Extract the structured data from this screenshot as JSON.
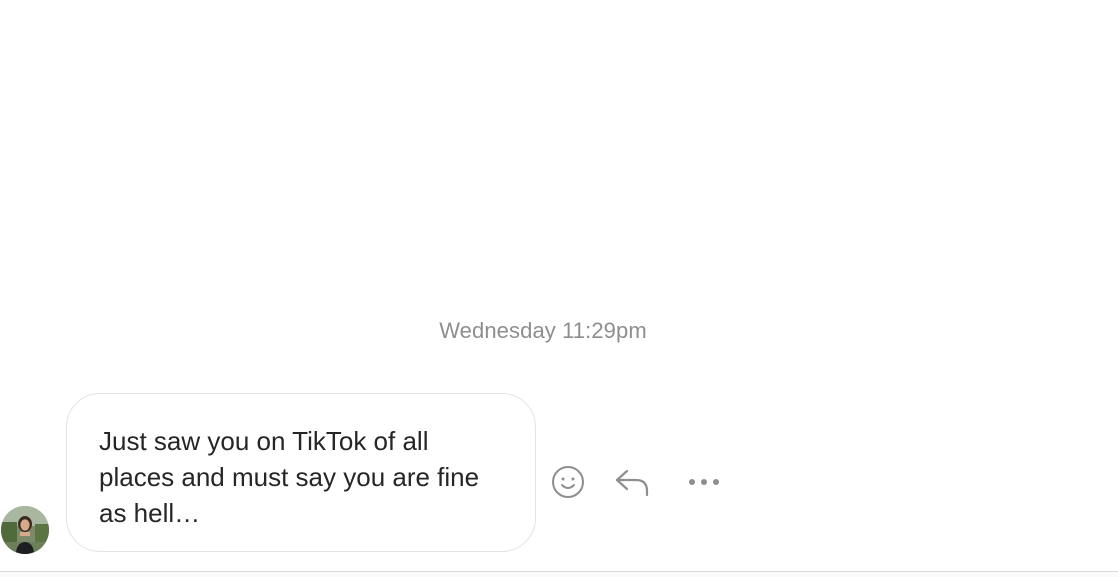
{
  "thread": {
    "timestamp": "Wednesday 11:29pm",
    "messages": [
      {
        "sender_avatar": "avatar",
        "text": "Just saw you on TikTok of all places and must say you are fine as hell…",
        "actions": [
          {
            "name": "react",
            "icon": "smiley-icon"
          },
          {
            "name": "reply",
            "icon": "reply-arrow-icon"
          },
          {
            "name": "more",
            "icon": "more-dots-icon"
          }
        ]
      }
    ]
  },
  "colors": {
    "timestamp": "#8e8e8e",
    "message_text": "#262626",
    "bubble_border": "#e3e3e3",
    "icon": "#8e8e8e"
  }
}
